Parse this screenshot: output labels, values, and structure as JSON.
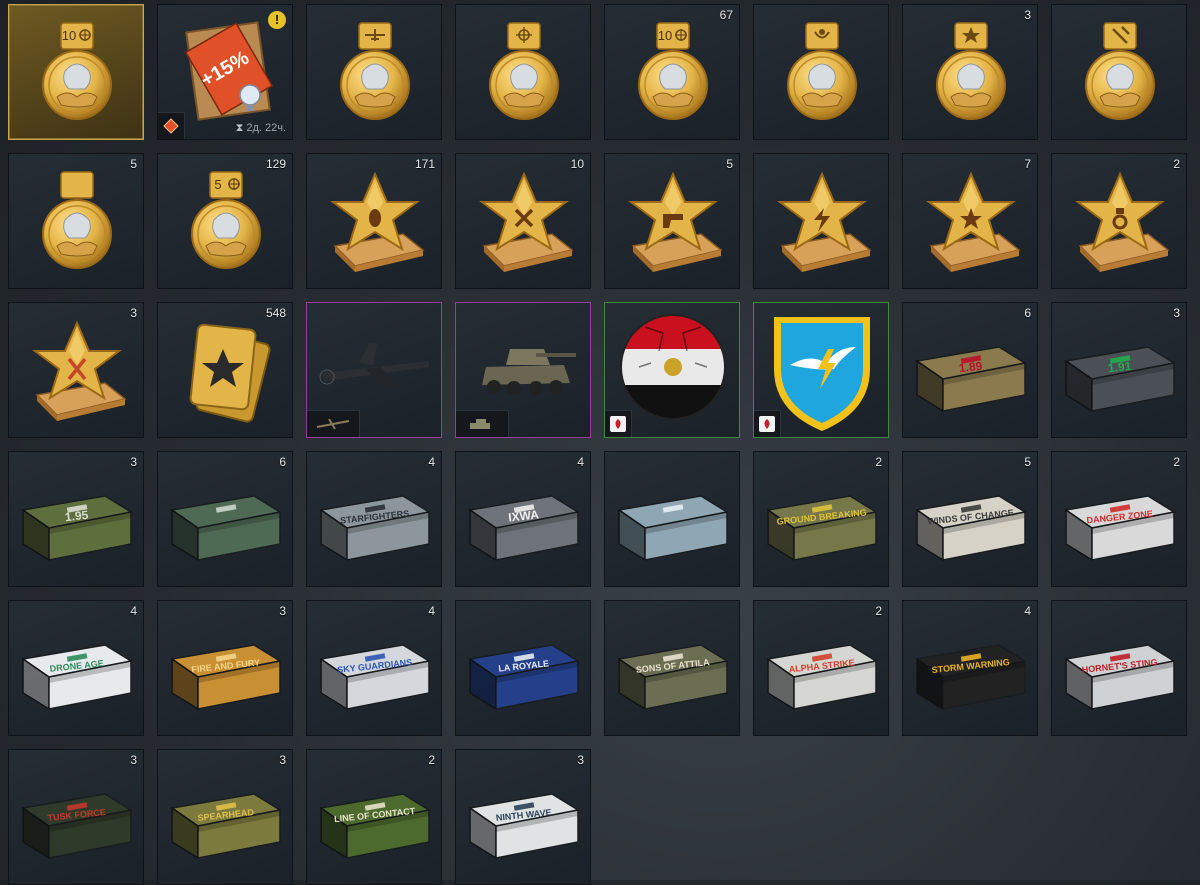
{
  "rows": [
    [
      {
        "kind": "medal",
        "label": "10",
        "count": "",
        "badge": "crosshair",
        "selected": true,
        "icon": "lion-medal-icon"
      },
      {
        "kind": "booster",
        "label": "+15%",
        "count": "",
        "exclaim": "!",
        "timer": "2д. 22ч.",
        "icon": "booster-card-icon"
      },
      {
        "kind": "medal",
        "label": "",
        "count": "",
        "badge": "plane",
        "icon": "lion-medal-icon"
      },
      {
        "kind": "medal",
        "label": "",
        "count": "",
        "badge": "crosshair",
        "icon": "lion-medal-icon"
      },
      {
        "kind": "medal",
        "label": "10",
        "count": "67",
        "badge": "crosshair",
        "icon": "lion-medal-icon"
      },
      {
        "kind": "medal",
        "label": "",
        "count": "",
        "badge": "wreath",
        "icon": "lion-medal-icon"
      },
      {
        "kind": "medal",
        "label": "",
        "count": "3",
        "badge": "star",
        "icon": "lion-medal-icon"
      },
      {
        "kind": "medal",
        "label": "",
        "count": "",
        "badge": "hammer",
        "icon": "lion-medal-icon"
      }
    ],
    [
      {
        "kind": "medal",
        "label": "",
        "count": "5",
        "badge": "",
        "icon": "lion-medal-icon"
      },
      {
        "kind": "medal",
        "label": "5",
        "count": "129",
        "badge": "crosshair",
        "icon": "lion-medal-icon"
      },
      {
        "kind": "star",
        "count": "171",
        "glyph": "bomb",
        "icon": "gold-star-icon"
      },
      {
        "kind": "star",
        "count": "10",
        "glyph": "swords",
        "icon": "gold-star-icon"
      },
      {
        "kind": "star",
        "count": "5",
        "glyph": "pistol",
        "icon": "gold-star-icon"
      },
      {
        "kind": "star",
        "count": "",
        "glyph": "bolt",
        "icon": "gold-star-icon"
      },
      {
        "kind": "star",
        "count": "7",
        "glyph": "star",
        "icon": "gold-star-icon"
      },
      {
        "kind": "star",
        "count": "2",
        "glyph": "medal",
        "icon": "gold-star-icon"
      }
    ],
    [
      {
        "kind": "star",
        "count": "3",
        "glyph": "cross",
        "icon": "gold-star-icon"
      },
      {
        "kind": "cards",
        "count": "548",
        "icon": "card-stack-icon"
      },
      {
        "kind": "plane",
        "count": "",
        "border": "purple",
        "icon": "aircraft-icon"
      },
      {
        "kind": "tank",
        "count": "",
        "border": "purple",
        "icon": "armored-car-icon"
      },
      {
        "kind": "ball",
        "count": "",
        "border": "green",
        "icon": "football-decal-icon"
      },
      {
        "kind": "shield",
        "count": "",
        "border": "green",
        "icon": "shield-decal-icon"
      },
      {
        "kind": "crate",
        "count": "6",
        "label": "1.89",
        "color": "#8a7a4e",
        "accent": "#b8122a",
        "icon": "crate-icon"
      },
      {
        "kind": "crate",
        "count": "3",
        "label": "1.91",
        "color": "#4a5055",
        "accent": "#1fae4c",
        "icon": "crate-icon"
      }
    ],
    [
      {
        "kind": "crate",
        "count": "3",
        "label": "1.95",
        "color": "#5e6e3c",
        "accent": "#d8dcd0",
        "icon": "crate-icon"
      },
      {
        "kind": "crate",
        "count": "6",
        "label": "",
        "color": "#4e6a54",
        "accent": "#cfd6cc",
        "icon": "crate-icon"
      },
      {
        "kind": "crate",
        "count": "4",
        "label": "STARFIGHTERS",
        "color": "#8d969c",
        "accent": "#2a3036",
        "icon": "crate-icon"
      },
      {
        "kind": "crate",
        "count": "4",
        "label": "IXWA",
        "color": "#6d7378",
        "accent": "#f0f0f0",
        "icon": "crate-icon"
      },
      {
        "kind": "crate",
        "count": "",
        "label": "",
        "color": "#8fa6b4",
        "accent": "#e8eef2",
        "icon": "crate-icon"
      },
      {
        "kind": "crate",
        "count": "2",
        "label": "GROUND BREAKING",
        "color": "#76784a",
        "accent": "#e2c23a",
        "icon": "crate-icon"
      },
      {
        "kind": "crate",
        "count": "5",
        "label": "WINDS OF CHANGE",
        "color": "#d6d2c8",
        "accent": "#3a3a3a",
        "icon": "crate-icon"
      },
      {
        "kind": "crate",
        "count": "2",
        "label": "DANGER ZONE",
        "color": "#d9d9d9",
        "accent": "#d12a2a",
        "icon": "crate-icon"
      }
    ],
    [
      {
        "kind": "crate",
        "count": "4",
        "label": "DRONE AGE",
        "color": "#e6eaec",
        "accent": "#2e8a5a",
        "icon": "crate-icon"
      },
      {
        "kind": "crate",
        "count": "3",
        "label": "FIRE AND FURY",
        "color": "#c98f33",
        "accent": "#f3d58a",
        "icon": "crate-icon"
      },
      {
        "kind": "crate",
        "count": "4",
        "label": "SKY GUARDIANS",
        "color": "#d4d8dc",
        "accent": "#2b55b5",
        "icon": "crate-icon"
      },
      {
        "kind": "crate",
        "count": "",
        "label": "LA ROYALE",
        "color": "#25408a",
        "accent": "#e8ecf2",
        "icon": "crate-icon"
      },
      {
        "kind": "crate",
        "count": "",
        "label": "SONS OF ATTILA",
        "color": "#6b6e52",
        "accent": "#e8e0d0",
        "icon": "crate-icon"
      },
      {
        "kind": "crate",
        "count": "2",
        "label": "ALPHA STRIKE",
        "color": "#d5d6d2",
        "accent": "#d1402a",
        "icon": "crate-icon"
      },
      {
        "kind": "crate",
        "count": "4",
        "label": "STORM WARNING",
        "color": "#222222",
        "accent": "#e8b320",
        "icon": "crate-icon"
      },
      {
        "kind": "crate",
        "count": "",
        "label": "HORNET'S STING",
        "color": "#cfd2d4",
        "accent": "#c01d24",
        "icon": "crate-icon"
      }
    ],
    [
      {
        "kind": "crate",
        "count": "3",
        "label": "TUSK FORCE",
        "color": "#2f3a2a",
        "accent": "#c33a2c",
        "icon": "crate-icon"
      },
      {
        "kind": "crate",
        "count": "3",
        "label": "SPEARHEAD",
        "color": "#7c7a3c",
        "accent": "#e0c04a",
        "icon": "crate-icon"
      },
      {
        "kind": "crate",
        "count": "2",
        "label": "LINE OF CONTACT",
        "color": "#4d6a2e",
        "accent": "#e8e2c8",
        "icon": "crate-icon"
      },
      {
        "kind": "crate",
        "count": "3",
        "label": "NINTH WAVE",
        "color": "#dfe3e4",
        "accent": "#2a3f56",
        "icon": "crate-icon"
      }
    ]
  ],
  "palette": {
    "gold": "#e3b447",
    "gold_dark": "#9c6a16",
    "gold_light": "#ffe08a",
    "silver": "#d8dde2"
  }
}
